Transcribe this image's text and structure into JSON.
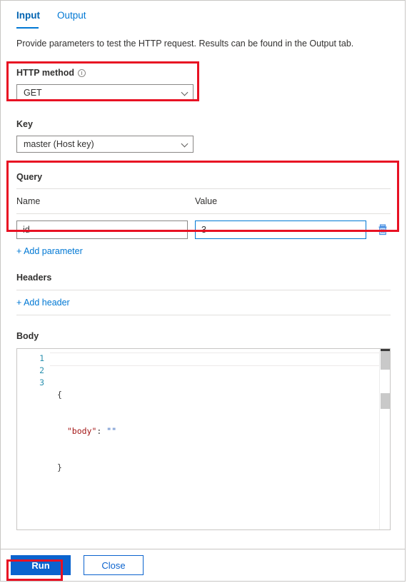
{
  "tabs": [
    {
      "label": "Input",
      "active": true
    },
    {
      "label": "Output",
      "active": false
    }
  ],
  "description": "Provide parameters to test the HTTP request. Results can be found in the Output tab.",
  "http_method": {
    "label": "HTTP method",
    "info_icon": "info-icon",
    "value": "GET",
    "chevron_icon": "chevron-down-icon"
  },
  "key": {
    "label": "Key",
    "value": "master (Host key)",
    "chevron_icon": "chevron-down-icon"
  },
  "query": {
    "title": "Query",
    "columns": {
      "name": "Name",
      "value": "Value"
    },
    "rows": [
      {
        "name": "id",
        "value": "3",
        "delete_icon": "trash-icon"
      }
    ],
    "add_link": "+ Add parameter"
  },
  "headers": {
    "title": "Headers",
    "add_link": "+ Add header"
  },
  "body": {
    "title": "Body",
    "line_numbers": [
      "1",
      "2",
      "3"
    ],
    "code_lines": [
      {
        "punct_before": "{",
        "key": "",
        "colon": "",
        "string": "",
        "punct_after": ""
      },
      {
        "punct_before": "  ",
        "key": "\"body\"",
        "colon": ": ",
        "string": "\"\"",
        "punct_after": ""
      },
      {
        "punct_before": "}",
        "key": "",
        "colon": "",
        "string": "",
        "punct_after": ""
      }
    ],
    "scrollbar_icon": "vertical-scrollbar"
  },
  "footer": {
    "run_label": "Run",
    "close_label": "Close"
  },
  "colors": {
    "accent": "#0078d4",
    "primary_button": "#0b63ce",
    "annotation": "#e81123",
    "json_key": "#a31515",
    "json_string": "#2b5fb8",
    "line_number": "#2b91af"
  }
}
